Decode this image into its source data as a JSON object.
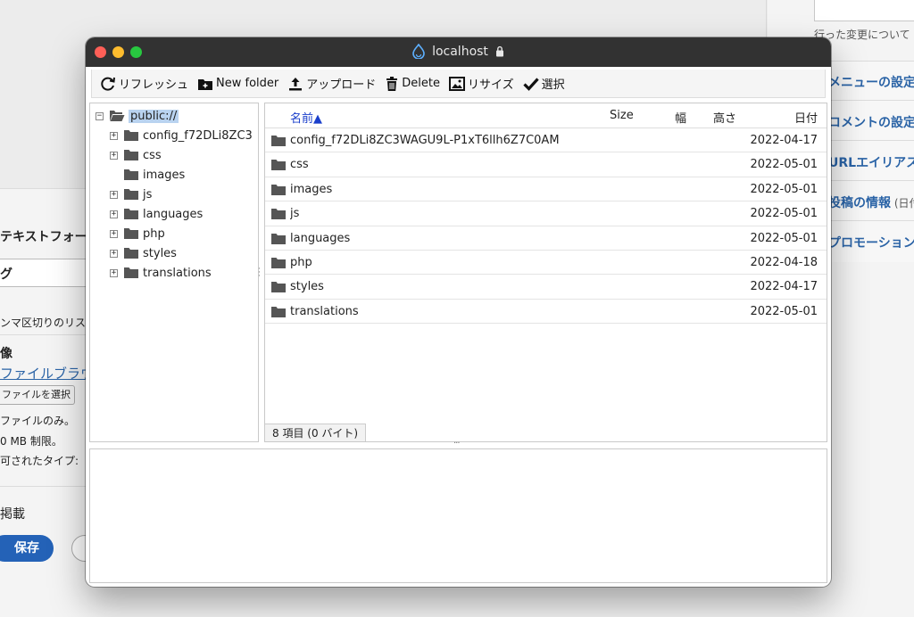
{
  "background": {
    "right_note": "行った変更について",
    "right_links": [
      {
        "label": "メニューの設定",
        "suffix": ""
      },
      {
        "label": "コメントの設定",
        "suffix": ""
      },
      {
        "label": "URLエイリアス",
        "suffix": ""
      },
      {
        "label": "投稿の情報",
        "suffix": " (日付"
      },
      {
        "label": "プロモーション",
        "suffix": ""
      }
    ],
    "left": {
      "text_format": "テキストフォーマ",
      "tags_label": "グ",
      "tags_help": "ンマ区切りのリス",
      "image_label": "像",
      "file_browser_link": "ファイルブラウ",
      "file_select_button": "ファイルを選択",
      "note_one_file": "ファイルのみ。",
      "note_size_limit": "0 MB 制限。",
      "note_types": "可されたタイプ:",
      "publish_label": "掲載",
      "save_button": "保存"
    }
  },
  "window": {
    "title": "localhost",
    "colors": {
      "titlebar": "#323232",
      "close": "#ff5f57",
      "minimize": "#febc2e",
      "maximize": "#28c840",
      "link": "#1a3fcb",
      "selection": "#b9d3f0"
    }
  },
  "toolbar": {
    "refresh": "リフレッシュ",
    "new_folder": "New folder",
    "upload": "アップロード",
    "delete": "Delete",
    "resize": "リサイズ",
    "select": "選択"
  },
  "tree": {
    "root": "public://",
    "children": [
      {
        "label": "config_f72DLi8ZC3",
        "expandable": true
      },
      {
        "label": "css",
        "expandable": true
      },
      {
        "label": "images",
        "expandable": false
      },
      {
        "label": "js",
        "expandable": true
      },
      {
        "label": "languages",
        "expandable": true
      },
      {
        "label": "php",
        "expandable": true
      },
      {
        "label": "styles",
        "expandable": true
      },
      {
        "label": "translations",
        "expandable": true
      }
    ]
  },
  "list": {
    "headers": {
      "name": "名前▲",
      "size": "Size",
      "width": "幅",
      "height": "高さ",
      "date": "日付"
    },
    "rows": [
      {
        "name": "config_f72DLi8ZC3WAGU9L-P1xT6llh6Z7C0AM",
        "date": "2022-04-17"
      },
      {
        "name": "css",
        "date": "2022-05-01"
      },
      {
        "name": "images",
        "date": "2022-05-01"
      },
      {
        "name": "js",
        "date": "2022-05-01"
      },
      {
        "name": "languages",
        "date": "2022-05-01"
      },
      {
        "name": "php",
        "date": "2022-04-18"
      },
      {
        "name": "styles",
        "date": "2022-04-17"
      },
      {
        "name": "translations",
        "date": "2022-05-01"
      }
    ],
    "status": "8 項目 (0 バイト)"
  }
}
